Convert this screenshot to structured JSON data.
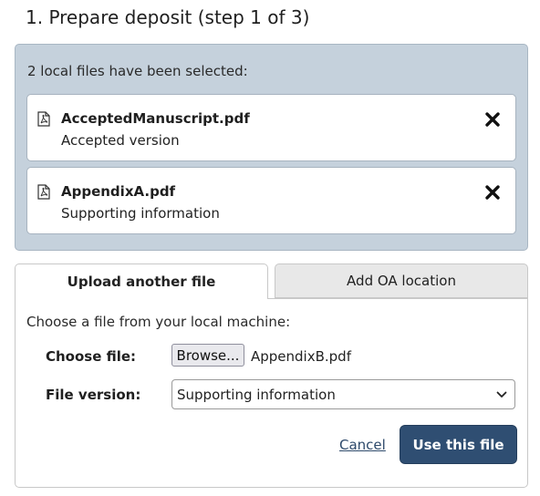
{
  "page": {
    "title": "1. Prepare deposit (step 1 of 3)"
  },
  "selected": {
    "summary": "2 local files have been selected:",
    "files": [
      {
        "name": "AcceptedManuscript.pdf",
        "version": "Accepted version",
        "icon": "pdf-file-icon",
        "remove_icon": "close-icon"
      },
      {
        "name": "AppendixA.pdf",
        "version": "Supporting information",
        "icon": "pdf-file-icon",
        "remove_icon": "close-icon"
      }
    ]
  },
  "upload": {
    "tabs": [
      {
        "label": "Upload another file",
        "active": true
      },
      {
        "label": "Add OA location",
        "active": false
      }
    ],
    "instructions": "Choose a file from your local machine:",
    "choose_file_label": "Choose file:",
    "browse_label": "Browse...",
    "chosen_file": "AppendixB.pdf",
    "file_version_label": "File version:",
    "file_version_value": "Supporting information",
    "cancel_label": "Cancel",
    "submit_label": "Use this file"
  },
  "colors": {
    "panel_bg": "#c5d1dc",
    "primary_button": "#2f4e72",
    "inactive_tab": "#e8e8e8",
    "link": "#2e4a6b"
  }
}
